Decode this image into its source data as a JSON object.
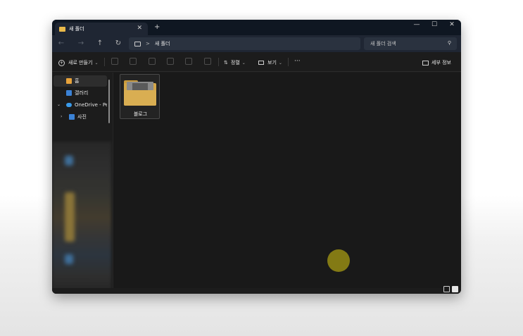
{
  "titlebar": {
    "tab_title": "새 폴더",
    "tab_close": "✕",
    "new_tab": "+",
    "minimize": "—",
    "maximize": "☐",
    "close": "✕"
  },
  "address": {
    "back": "←",
    "forward": "→",
    "up": "↑",
    "refresh": "↻",
    "path_separator": ">",
    "path_current": "새 폴더",
    "search_placeholder": "새 폴더 검색",
    "search_icon": "⚲"
  },
  "toolbar": {
    "new_label": "새로 만들기",
    "new_chevron": "⌄",
    "sort_label": "정렬",
    "sort_chevron": "⌄",
    "view_label": "보기",
    "view_chevron": "⌄",
    "more_label": "···",
    "details_label": "세부 정보"
  },
  "sidebar": {
    "items": [
      {
        "label": "홈"
      },
      {
        "label": "갤러리"
      },
      {
        "label": "OneDrive - Pers"
      },
      {
        "label": "사진"
      }
    ]
  },
  "content": {
    "items": [
      {
        "name": "블로그"
      }
    ]
  },
  "colors": {
    "accent_folder": "#d3a648",
    "titlebar": "#0f1722",
    "cursor_highlight": "#96 8c14"
  }
}
